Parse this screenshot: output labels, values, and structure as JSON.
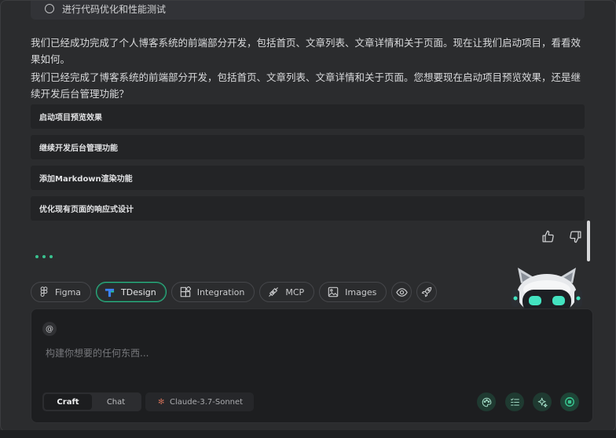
{
  "todo": {
    "label": "进行代码优化和性能测试"
  },
  "messages": [
    "我们已经成功完成了个人博客系统的前端部分开发，包括首页、文章列表、文章详情和关于页面。现在让我们启动项目，看看效果如何。",
    "我们已经完成了博客系统的前端部分开发，包括首页、文章列表、文章详情和关于页面。您想要现在启动项目预览效果，还是继续开发后台管理功能？"
  ],
  "options": [
    "启动项目预览效果",
    "继续开发后台管理功能",
    "添加Markdown渲染功能",
    "优化现有页面的响应式设计"
  ],
  "tools": [
    {
      "label": "Figma",
      "icon": "figma-icon"
    },
    {
      "label": "TDesign",
      "icon": "tdesign-icon",
      "active": true
    },
    {
      "label": "Integration",
      "icon": "integration-icon"
    },
    {
      "label": "MCP",
      "icon": "mcp-icon"
    },
    {
      "label": "Images",
      "icon": "image-icon"
    }
  ],
  "composer": {
    "at_label": "@",
    "placeholder": "构建你想要的任何东西...",
    "modes": [
      "Craft",
      "Chat"
    ],
    "active_mode": "Craft",
    "model": "Claude-3.7-Sonnet"
  },
  "colors": {
    "accent": "#2fb486",
    "background": "#2b2c2e",
    "composer": "#1d1e20"
  }
}
